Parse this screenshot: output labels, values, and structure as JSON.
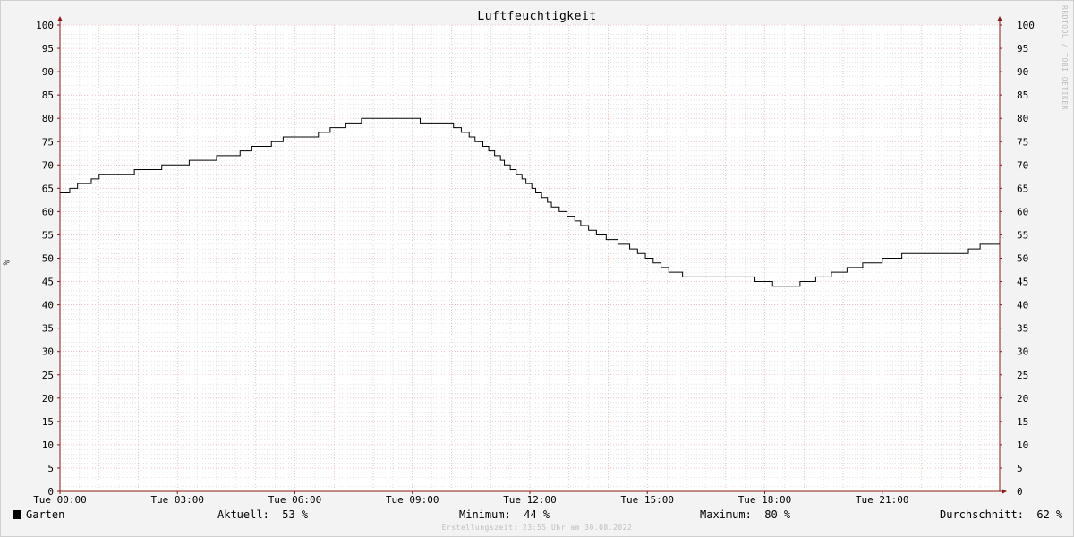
{
  "chart_data": {
    "type": "line",
    "title": "Luftfeuchtigkeit",
    "ylabel": "%",
    "ylim": [
      0,
      100
    ],
    "ytick_step": 5,
    "xlim_hours": [
      0,
      24
    ],
    "xticks": [
      {
        "hour": 0,
        "label": "Tue 00:00"
      },
      {
        "hour": 3,
        "label": "Tue 03:00"
      },
      {
        "hour": 6,
        "label": "Tue 06:00"
      },
      {
        "hour": 9,
        "label": "Tue 09:00"
      },
      {
        "hour": 12,
        "label": "Tue 12:00"
      },
      {
        "hour": 15,
        "label": "Tue 15:00"
      },
      {
        "hour": 18,
        "label": "Tue 18:00"
      },
      {
        "hour": 21,
        "label": "Tue 21:00"
      }
    ],
    "series": [
      {
        "name": "Garten",
        "color": "#000000",
        "hours": [
          0,
          0.15,
          0.25,
          0.45,
          0.55,
          0.8,
          1.0,
          1.35,
          1.9,
          2.6,
          3.3,
          4.0,
          4.6,
          4.9,
          5.1,
          5.4,
          5.7,
          6.1,
          6.6,
          6.9,
          7.3,
          7.7,
          8.0,
          8.5,
          9.0,
          9.2,
          9.5,
          9.9,
          10.05,
          10.25,
          10.45,
          10.6,
          10.8,
          10.95,
          11.1,
          11.25,
          11.35,
          11.5,
          11.65,
          11.8,
          11.9,
          12.05,
          12.15,
          12.3,
          12.45,
          12.55,
          12.75,
          12.95,
          13.15,
          13.3,
          13.5,
          13.7,
          13.95,
          14.25,
          14.55,
          14.75,
          14.95,
          15.15,
          15.35,
          15.55,
          15.9,
          16.3,
          16.8,
          17.3,
          17.75,
          18.2,
          18.6,
          18.9,
          19.3,
          19.7,
          20.1,
          20.5,
          21.0,
          21.5,
          22.0,
          22.6,
          23.2,
          23.5,
          24.0
        ],
        "values": [
          64,
          64,
          65,
          66,
          66,
          67,
          68,
          68,
          69,
          70,
          71,
          72,
          73,
          74,
          74,
          75,
          76,
          76,
          77,
          78,
          79,
          80,
          80,
          80,
          80,
          79,
          79,
          79,
          78,
          77,
          76,
          75,
          74,
          73,
          72,
          71,
          70,
          69,
          68,
          67,
          66,
          65,
          64,
          63,
          62,
          61,
          60,
          59,
          58,
          57,
          56,
          55,
          54,
          53,
          52,
          51,
          50,
          49,
          48,
          47,
          46,
          46,
          46,
          46,
          45,
          44,
          44,
          45,
          46,
          47,
          48,
          49,
          50,
          51,
          51,
          51,
          52,
          53,
          53
        ]
      }
    ],
    "legend": {
      "series_name": "Garten",
      "current_label": "Aktuell:",
      "current_value": "53 %",
      "min_label": "Minimum:",
      "min_value": "44 %",
      "max_label": "Maximum:",
      "max_value": "80 %",
      "avg_label": "Durchschnitt:",
      "avg_value": "62 %"
    },
    "watermark": "RRDTOOL / TOBI OETIKER",
    "footer": "Erstellungszeit: 23:55 Uhr am 30.08.2022",
    "colors": {
      "background": "#f3f3f3",
      "plot_background": "#ffffff",
      "major_grid": "#e6a0a0",
      "minor_grid": "#c8c8c8",
      "axis": "#8b1a1a",
      "line": "#000000"
    }
  }
}
